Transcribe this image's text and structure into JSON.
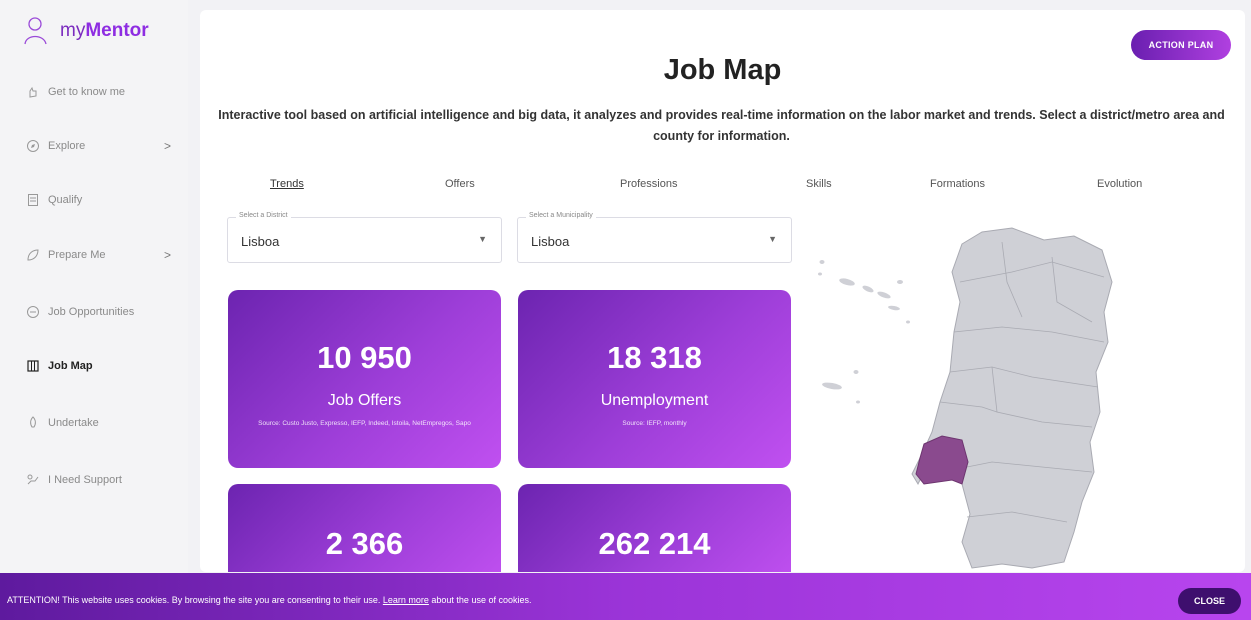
{
  "app": {
    "logo_light": "my",
    "logo_bold": "Mentor",
    "brand_color": "#8e2de2"
  },
  "sidebar": {
    "items": [
      {
        "label": "Get to know me",
        "icon": "hand-icon",
        "chevron": ""
      },
      {
        "label": "Explore",
        "icon": "compass-icon",
        "chevron": ">"
      },
      {
        "label": "Qualify",
        "icon": "document-icon",
        "chevron": ""
      },
      {
        "label": "Prepare Me",
        "icon": "leaf-icon",
        "chevron": ">"
      },
      {
        "label": "Job Opportunities",
        "icon": "briefcase-icon",
        "chevron": ""
      },
      {
        "label": "Job Map",
        "icon": "map-icon",
        "chevron": ""
      },
      {
        "label": "Undertake",
        "icon": "rocket-icon",
        "chevron": ""
      },
      {
        "label": "I Need Support",
        "icon": "support-icon",
        "chevron": ""
      }
    ]
  },
  "header": {
    "action_label": "ACTION PLAN",
    "title": "Job Map",
    "subtitle": "Interactive tool based on artificial intelligence and big data, it analyzes and provides real-time information on the labor market and trends. Select a district/metro area and county for information."
  },
  "tabs": [
    "Trends",
    "Offers",
    "Professions",
    "Skills",
    "Formations",
    "Evolution"
  ],
  "filters": {
    "district": {
      "label": "Select a District",
      "value": "Lisboa"
    },
    "municipality": {
      "label": "Select a Municipality",
      "value": "Lisboa"
    }
  },
  "cards": [
    {
      "number": "10 950",
      "caption": "Job Offers",
      "source": "Source: Custo Justo, Expresso, IEFP, Indeed, Istoila, NetEmpregos, Sapo"
    },
    {
      "number": "18 318",
      "caption": "Unemployment",
      "source": "Source: IEFP, monthly"
    },
    {
      "number": "2 366",
      "caption": "",
      "source": ""
    },
    {
      "number": "262 214",
      "caption": "",
      "source": ""
    }
  ],
  "map": {
    "selected_region": "Lisboa",
    "selected_color": "#8a4a8e",
    "base_color": "#cfd0d6"
  },
  "cookie": {
    "text_before": "ATTENTION! This website uses cookies. By browsing the site you are consenting to their use.",
    "link": "Learn more",
    "text_after": "about the use of cookies.",
    "close_label": "CLOSE"
  }
}
